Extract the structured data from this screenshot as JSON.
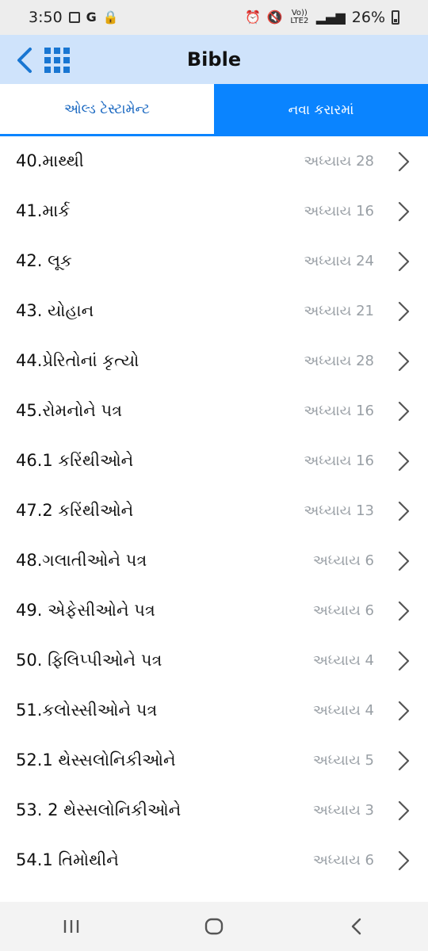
{
  "status_bar": {
    "time": "3:50",
    "network": "Vo)) LTE2",
    "battery": "26%",
    "icons": [
      "image-icon",
      "google-icon",
      "lock-icon",
      "alarm-icon",
      "mute-icon",
      "signal-icon",
      "battery-icon"
    ]
  },
  "app_bar": {
    "title": "Bible",
    "back_icon": "back-arrow-icon",
    "grid_icon": "grid-menu-icon"
  },
  "tabs": {
    "old_testament": "ઓલ્ડ ટેસ્ટામેન્ટ",
    "new_testament": "નવા કરારમાં"
  },
  "books": [
    {
      "name": "40.માથ્થી",
      "chapters": "અધ્યાય 28"
    },
    {
      "name": "41.માર્ક",
      "chapters": "અધ્યાય 16"
    },
    {
      "name": "42. લૂક",
      "chapters": "અધ્યાય 24"
    },
    {
      "name": "43. યોહાન",
      "chapters": "અધ્યાય 21"
    },
    {
      "name": "44.પ્રેરિતોનાં કૃત્યો",
      "chapters": "અધ્યાય 28"
    },
    {
      "name": "45.રોમનોને પત્ર",
      "chapters": "અધ્યાય 16"
    },
    {
      "name": "46.1 કરિંથીઓને",
      "chapters": "અધ્યાય 16"
    },
    {
      "name": "47.2 કરિંથીઓને",
      "chapters": "અધ્યાય 13"
    },
    {
      "name": "48.ગલાતીઓને પત્ર",
      "chapters": "અધ્યાય 6"
    },
    {
      "name": "49. એફેસીઓને પત્ર",
      "chapters": "અધ્યાય 6"
    },
    {
      "name": "50. ફિલિપ્પીઓને પત્ર",
      "chapters": "અધ્યાય 4"
    },
    {
      "name": "51.કલોસ્સીઓને પત્ર",
      "chapters": "અધ્યાય 4"
    },
    {
      "name": "52.1 થેસ્સલોનિકીઓને",
      "chapters": "અધ્યાય 5"
    },
    {
      "name": "53. 2 થેસ્સલોનિકીઓને",
      "chapters": "અધ્યાય 3"
    },
    {
      "name": "54.1 તિમોથીને",
      "chapters": "અધ્યાય 6"
    }
  ],
  "nav_bar": {
    "icons": [
      "recent-apps-icon",
      "home-icon",
      "back-icon"
    ]
  },
  "colors": {
    "accent": "#0a84ff",
    "app_bar_bg": "#cfe3fb",
    "chapter_text": "#9aa0a6"
  }
}
